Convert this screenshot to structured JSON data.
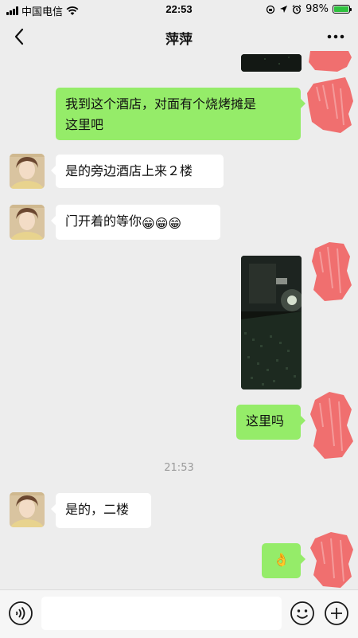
{
  "status_bar": {
    "carrier": "中国电信",
    "time": "22:53",
    "battery_percent": "98%",
    "battery_level": 0.98,
    "icons": [
      "signal-icon",
      "wifi-icon",
      "orientation-lock-icon",
      "location-icon",
      "alarm-icon",
      "battery-icon"
    ]
  },
  "header": {
    "title": "萍萍",
    "back_icon": "chevron-left-icon",
    "more_icon": "more-dots-icon"
  },
  "messages": [
    {
      "type": "image",
      "sender": "self",
      "content": "partial photo (top, cut off)"
    },
    {
      "type": "text",
      "sender": "self",
      "line1": "我到这个酒店，对面有个烧烤摊是",
      "line2": "这里吧"
    },
    {
      "type": "text",
      "sender": "contact",
      "text": "是的旁边酒店上来２楼"
    },
    {
      "type": "text",
      "sender": "contact",
      "text": "门开着的等你",
      "emoji": "😁😁😁"
    },
    {
      "type": "image",
      "sender": "self",
      "content": "night photo of alley"
    },
    {
      "type": "text",
      "sender": "self",
      "text": "这里吗"
    },
    {
      "type": "timestamp",
      "text": "21:53"
    },
    {
      "type": "text",
      "sender": "contact",
      "text": "是的，二楼"
    },
    {
      "type": "emoji",
      "sender": "self",
      "text": "👌"
    }
  ],
  "input_bar": {
    "voice_icon": "voice-icon",
    "emoji_icon": "emoji-face-icon",
    "plus_icon": "plus-circle-icon",
    "placeholder": ""
  },
  "colors": {
    "background": "#ededed",
    "outgoing_bubble": "#95ec69",
    "incoming_bubble": "#ffffff",
    "timestamp": "#9b9b9b",
    "redaction": "#f06f6f"
  }
}
